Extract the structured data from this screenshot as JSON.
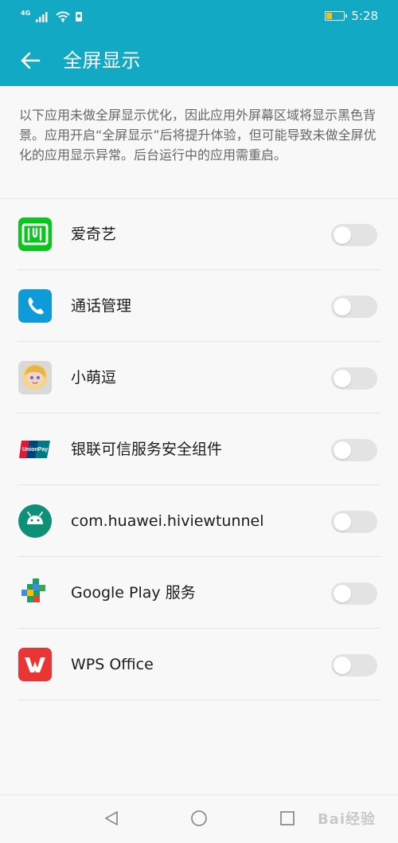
{
  "status_bar": {
    "network": "4G",
    "time": "5:28",
    "icons": [
      "signal-icon",
      "wifi-icon",
      "battery-icon"
    ]
  },
  "header": {
    "back_icon": "arrow-left-icon",
    "title": "全屏显示"
  },
  "description": "以下应用未做全屏显示优化，因此应用外屏幕区域将显示黑色背景。应用开启“全屏显示”后将提升体验，但可能导致未做全屏优化的应用显示异常。后台运行中的应用需重启。",
  "apps": [
    {
      "name": "爱奇艺",
      "enabled": false,
      "icon": "iqiyi-icon"
    },
    {
      "name": "通话管理",
      "enabled": false,
      "icon": "phone-icon"
    },
    {
      "name": "小萌逗",
      "enabled": false,
      "icon": "avatar-icon"
    },
    {
      "name": "银联可信服务安全组件",
      "enabled": false,
      "icon": "unionpay-icon"
    },
    {
      "name": "com.huawei.hiviewtunnel",
      "enabled": false,
      "icon": "android-icon"
    },
    {
      "name": "Google Play 服务",
      "enabled": false,
      "icon": "google-play-services-icon"
    },
    {
      "name": "WPS Office",
      "enabled": false,
      "icon": "wps-office-icon"
    }
  ],
  "navigation": {
    "back": "nav-back-icon",
    "home": "nav-home-icon",
    "recent": "nav-recent-icon"
  },
  "watermark": "Bai经验",
  "colors": {
    "header": "#12a9c4",
    "background": "#f8f8f8",
    "toggle_off": "#e3e3e3"
  }
}
